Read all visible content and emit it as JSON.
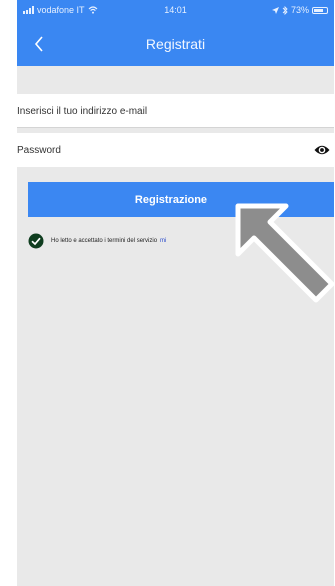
{
  "status_bar": {
    "carrier": "vodafone IT",
    "time": "14:01",
    "battery": "73%",
    "battery_level": 0.73
  },
  "nav": {
    "title": "Registrati"
  },
  "form": {
    "email_placeholder": "Inserisci il tuo indirizzo e-mail",
    "password_placeholder": "Password",
    "submit_label": "Registrazione"
  },
  "terms": {
    "text": "Ho letto e accettato i termini del servizio",
    "link_text": "mi",
    "checked": true
  },
  "icons": {
    "back": "chevron-left-icon",
    "eye": "eye-icon",
    "check": "check-circle-icon",
    "wifi": "wifi-icon",
    "battery": "battery-icon",
    "bluetooth": "bluetooth-icon",
    "location": "location-arrow-icon",
    "pointer": "pointer-arrow-icon"
  },
  "colors": {
    "accent": "#3a87f2",
    "background": "#e9e9e9",
    "check": "#0f3d1f",
    "link": "#2a4bcc"
  }
}
